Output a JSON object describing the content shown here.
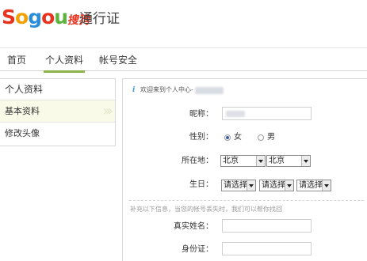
{
  "header": {
    "logo_text": "Sogou搜狗",
    "title": "通行证"
  },
  "nav": {
    "tabs": [
      {
        "label": "首页",
        "active": false
      },
      {
        "label": "个人资料",
        "active": true
      },
      {
        "label": "帐号安全",
        "active": false
      }
    ],
    "accent_color": "#8ab34a"
  },
  "sidebar": {
    "title": "个人资料",
    "items": [
      {
        "label": "基本资料",
        "active": true
      },
      {
        "label": "修改头像",
        "active": false
      }
    ]
  },
  "main": {
    "welcome": "欢迎来到个人中心-",
    "form": {
      "nickname_label": "昵称：",
      "gender_label": "性别：",
      "gender_options": [
        {
          "label": "女",
          "checked": true
        },
        {
          "label": "男",
          "checked": false
        }
      ],
      "location_label": "所在地：",
      "province": "北京",
      "city": "北京",
      "birthday_label": "生日：",
      "birthday_year": "请选择",
      "birthday_month": "请选择",
      "birthday_day": "请选择"
    },
    "hint": "补充以下信息，当您的帐号丢失时，我们可以帮你找回",
    "recovery": {
      "realname_label": "真实姓名：",
      "idcard_label": "身份证："
    }
  },
  "icons": [
    "info-icon",
    "dropdown-arrow-icon"
  ]
}
